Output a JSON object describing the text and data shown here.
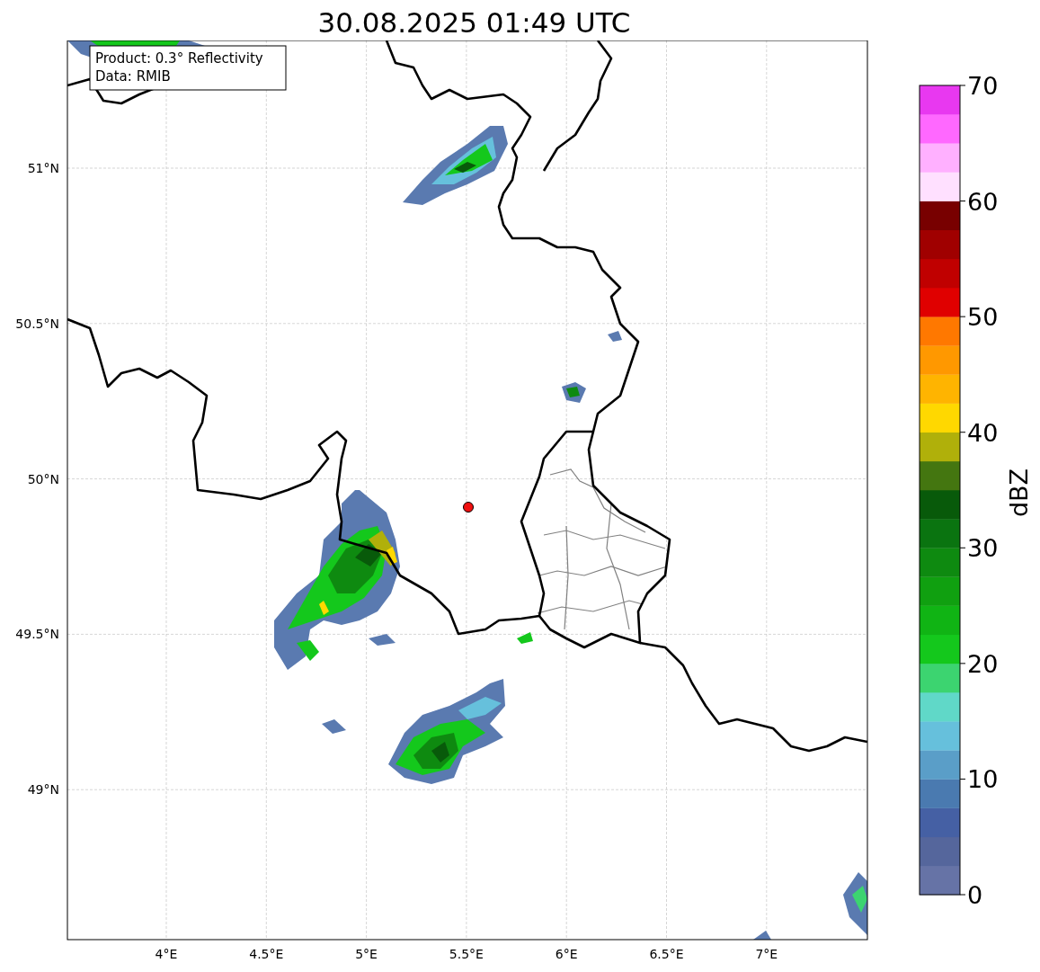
{
  "title": "30.08.2025 01:49 UTC",
  "map": {
    "info_box": [
      "Product: 0.3° Reflectivity",
      "Data: RMIB"
    ],
    "lat_labels": [
      "51°N",
      "50.5°N",
      "50°N",
      "49.5°N",
      "49°N"
    ],
    "lon_labels": [
      "4°E",
      "4.5°E",
      "5°E",
      "5.5°E",
      "6°E",
      "6.5°E",
      "7°E"
    ]
  },
  "colorbar": {
    "label": "dBZ",
    "ticks": [
      "70",
      "60",
      "50",
      "40",
      "30",
      "20",
      "10",
      "0"
    ],
    "segments": [
      {
        "color": "#6673a6"
      },
      {
        "color": "#55669c"
      },
      {
        "color": "#4560a4"
      },
      {
        "color": "#4a7ab0"
      },
      {
        "color": "#5a9ec8"
      },
      {
        "color": "#66c0dc"
      },
      {
        "color": "#60d8c8"
      },
      {
        "color": "#3cd470"
      },
      {
        "color": "#14c81c"
      },
      {
        "color": "#10b414"
      },
      {
        "color": "#10a010"
      },
      {
        "color": "#0e8a10"
      },
      {
        "color": "#0a7410"
      },
      {
        "color": "#085a0a"
      },
      {
        "color": "#447610"
      },
      {
        "color": "#b0b00a"
      },
      {
        "color": "#ffd800"
      },
      {
        "color": "#ffb400"
      },
      {
        "color": "#ff9800"
      },
      {
        "color": "#ff7800"
      },
      {
        "color": "#e00000"
      },
      {
        "color": "#c00000"
      },
      {
        "color": "#a00000"
      },
      {
        "color": "#780000"
      },
      {
        "color": "#ffe0ff"
      },
      {
        "color": "#ffb0ff"
      },
      {
        "color": "#ff68ff"
      },
      {
        "color": "#e838f0"
      }
    ]
  }
}
